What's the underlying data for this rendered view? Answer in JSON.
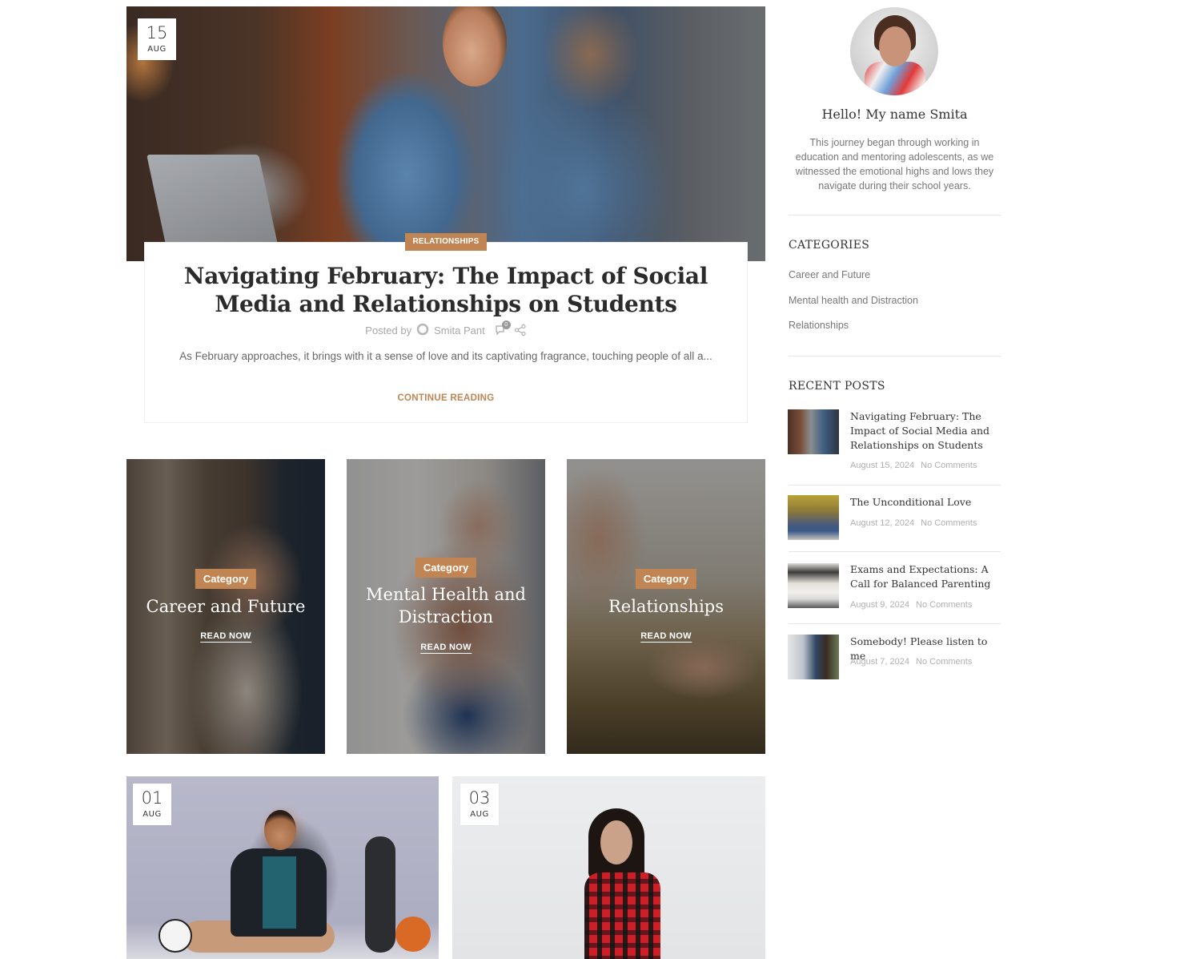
{
  "featured_post": {
    "date_day": "15",
    "date_month": "AUG",
    "category": "RELATIONSHIPS",
    "title": "Navigating February: The Impact of Social Media and Relationships on Students",
    "posted_by_label": "Posted by",
    "author": "Smita Pant",
    "comment_count": "0",
    "excerpt": "As February approaches, it brings with it a sense of love and its captivating fragrance, touching people of all a...",
    "continue_label": "CONTINUE READING",
    "icons": {
      "author": "user-icon",
      "comments": "comment-icon",
      "share": "share-icon"
    }
  },
  "category_tiles": [
    {
      "tag": "Category",
      "title": "Career and Future",
      "cta": "READ NOW"
    },
    {
      "tag": "Category",
      "title": "Mental Health and Distraction",
      "cta": "READ NOW"
    },
    {
      "tag": "Category",
      "title": "Relationships",
      "cta": "READ NOW"
    }
  ],
  "posts": [
    {
      "date_day": "01",
      "date_month": "AUG"
    },
    {
      "date_day": "03",
      "date_month": "AUG"
    }
  ],
  "sidebar": {
    "greeting": "Hello! My name Smita",
    "bio": "This journey began through working in education and mentoring adolescents, as we witnessed the emotional highs and lows they navigate during their school years.",
    "categories_title": "CATEGORIES",
    "categories": [
      "Career and Future",
      "Mental health and Distraction",
      "Relationships"
    ],
    "recent_title": "RECENT POSTS",
    "recent_posts": [
      {
        "title": "Navigating February: The Impact of Social Media and Relationships on Students",
        "date": "August 15, 2024",
        "comments": "No Comments"
      },
      {
        "title": "The Unconditional Love",
        "date": "August 12, 2024",
        "comments": "No Comments"
      },
      {
        "title": "Exams and Expectations: A Call for Balanced Parenting",
        "date": "August 9, 2024",
        "comments": "No Comments"
      },
      {
        "title": "Somebody! Please listen to me",
        "date": "August 7, 2024",
        "comments": "No Comments"
      }
    ]
  },
  "colors": {
    "accent": "#c08552",
    "text": "#333333",
    "muted": "#777777",
    "meta": "#b0b0b0"
  }
}
